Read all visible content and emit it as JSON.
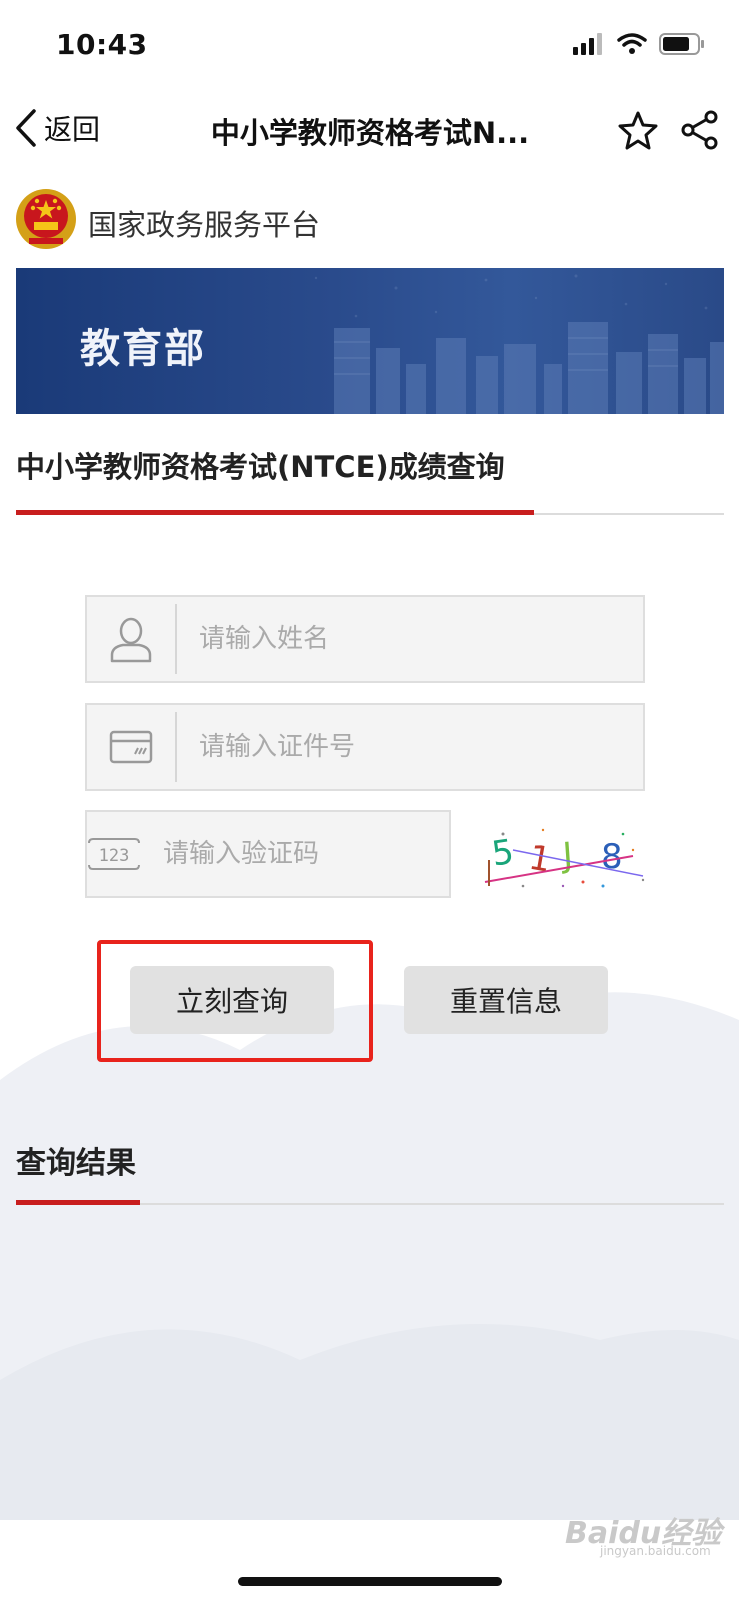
{
  "status_bar": {
    "time": "10:43",
    "icons": [
      "signal-icon",
      "wifi-icon",
      "battery-icon"
    ]
  },
  "nav": {
    "back_label": "返回",
    "title": "中小学教师资格考试N...",
    "icons": [
      "star-icon",
      "share-icon"
    ]
  },
  "platform": {
    "name": "国家政务服务平台"
  },
  "banner": {
    "title": "教育部"
  },
  "section": {
    "title": "中小学教师资格考试(NTCE)成绩查询"
  },
  "form": {
    "name_placeholder": "请输入姓名",
    "id_placeholder": "请输入证件号",
    "captcha_placeholder": "请输入验证码",
    "captcha_text": "51J8",
    "captcha_icon_text": "123"
  },
  "buttons": {
    "query": "立刻查询",
    "reset": "重置信息"
  },
  "results": {
    "title": "查询结果"
  },
  "watermark": {
    "text": "Baidu经验",
    "sub": "jingyan.baidu.com"
  },
  "colors": {
    "accent_red": "#c81e1e",
    "highlight_red": "#e8231c",
    "banner_blue": "#2a4b8c"
  }
}
